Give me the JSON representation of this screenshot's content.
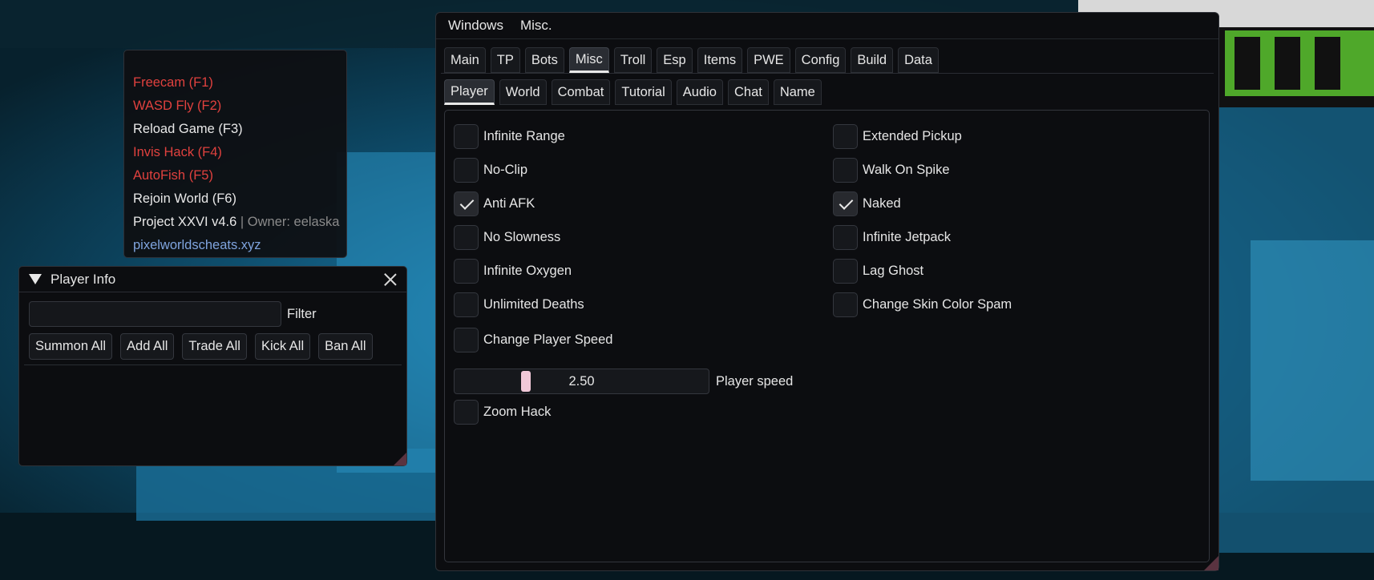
{
  "overlay": {
    "lines": [
      {
        "text": "Freecam (F1)",
        "color": "#e0413e"
      },
      {
        "text": "WASD Fly (F2)",
        "color": "#e0413e"
      },
      {
        "text": "Reload Game (F3)",
        "color": "#e8e8e8"
      },
      {
        "text": "Invis Hack (F4)",
        "color": "#e0413e"
      },
      {
        "text": "AutoFish (F5)",
        "color": "#e0413e"
      },
      {
        "text": "Rejoin World (F6)",
        "color": "#e8e8e8"
      }
    ],
    "version": "Project XXVI v4.6",
    "owner": "| Owner: eelaska",
    "link": "pixelworldscheats.xyz"
  },
  "player_info": {
    "title": "Player Info",
    "filter_value": "",
    "filter_label": "Filter",
    "buttons": [
      "Summon All",
      "Add All",
      "Trade All",
      "Kick All",
      "Ban All"
    ]
  },
  "main": {
    "menu": [
      "Windows",
      "Misc."
    ],
    "tabs": [
      "Main",
      "TP",
      "Bots",
      "Misc",
      "Troll",
      "Esp",
      "Items",
      "PWE",
      "Config",
      "Build",
      "Data"
    ],
    "active_tab": "Misc",
    "subtabs": [
      "Player",
      "World",
      "Combat",
      "Tutorial",
      "Audio",
      "Chat",
      "Name"
    ],
    "active_subtab": "Player",
    "left_options": [
      {
        "label": "Infinite Range",
        "checked": false
      },
      {
        "label": "No-Clip",
        "checked": false
      },
      {
        "label": "Anti AFK",
        "checked": true
      },
      {
        "label": "No Slowness",
        "checked": false
      },
      {
        "label": "Infinite Oxygen",
        "checked": false
      },
      {
        "label": "Unlimited Deaths",
        "checked": false
      },
      {
        "label": "Change Player Speed",
        "checked": false
      }
    ],
    "right_options": [
      {
        "label": "Extended Pickup",
        "checked": false
      },
      {
        "label": "Walk On Spike",
        "checked": false
      },
      {
        "label": "Naked",
        "checked": true
      },
      {
        "label": "Infinite Jetpack",
        "checked": false
      },
      {
        "label": "Lag Ghost",
        "checked": false
      },
      {
        "label": "Change Skin Color Spam",
        "checked": false
      }
    ],
    "speed_slider": {
      "value": "2.50",
      "label": "Player speed",
      "fraction": 0.27
    },
    "zoom_hack": {
      "label": "Zoom Hack",
      "checked": false
    }
  }
}
